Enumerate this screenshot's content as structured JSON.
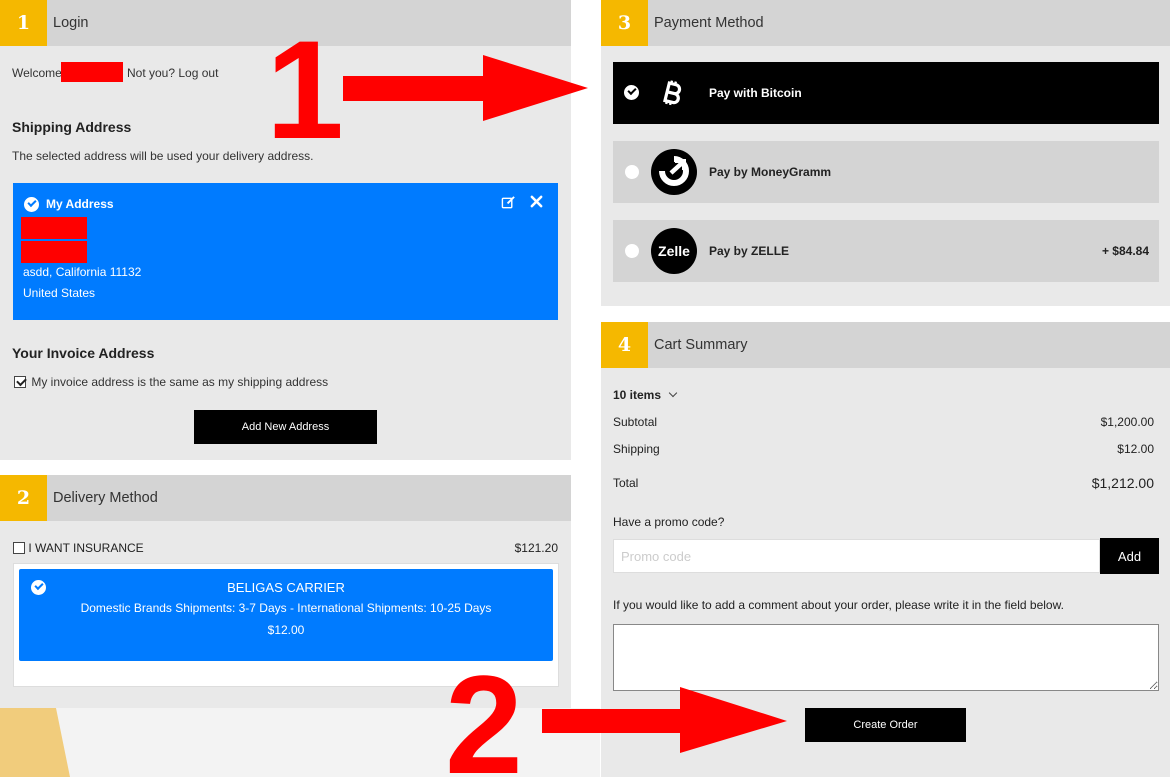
{
  "login": {
    "step": "1",
    "title": "Login",
    "welcome": "Welcome",
    "not_you": "Not you? Log out"
  },
  "shipping": {
    "heading": "Shipping Address",
    "subtext": "The selected address will be used your delivery address.",
    "address": {
      "name": "My Address",
      "line_city": "asdd, California 11132",
      "country": "United States"
    }
  },
  "invoice": {
    "heading": "Your Invoice Address",
    "same_label": "My invoice address is the same as my shipping address",
    "same_checked": true,
    "add_button": "Add New Address"
  },
  "delivery": {
    "step": "2",
    "title": "Delivery Method",
    "insurance_label": "I WANT INSURANCE",
    "insurance_price": "$121.20",
    "carrier": {
      "name": "BELIGAS CARRIER",
      "description": "Domestic Brands Shipments: 3-7 Days - International Shipments: 10-25 Days",
      "price": "$12.00"
    }
  },
  "payment": {
    "step": "3",
    "title": "Payment Method",
    "options": [
      {
        "label": "Pay with Bitcoin",
        "icon": "bitcoin-icon",
        "selected": true,
        "fee": ""
      },
      {
        "label": "Pay by MoneyGramm",
        "icon": "moneygram-icon",
        "selected": false,
        "fee": ""
      },
      {
        "label": "Pay by ZELLE",
        "icon": "zelle-icon",
        "logo_text": "Zelle",
        "selected": false,
        "fee": "+ $84.84"
      }
    ]
  },
  "cart": {
    "step": "4",
    "title": "Cart Summary",
    "items_count": "10 items",
    "subtotal_label": "Subtotal",
    "subtotal": "$1,200.00",
    "shipping_label": "Shipping",
    "shipping": "$12.00",
    "total_label": "Total",
    "total": "$1,212.00",
    "promo_question": "Have a promo code?",
    "promo_placeholder": "Promo code",
    "promo_button": "Add",
    "comment_label": "If you would like to add a comment about your order, please write it in the field below.",
    "create_order": "Create Order"
  },
  "annotations": {
    "one": "1",
    "two": "2"
  },
  "colors": {
    "accent_blue": "#007bff",
    "step_yellow": "#f5b800",
    "annotation_red": "#ff0000",
    "panel_gray": "#e9e9e9",
    "header_gray": "#d4d4d4"
  }
}
